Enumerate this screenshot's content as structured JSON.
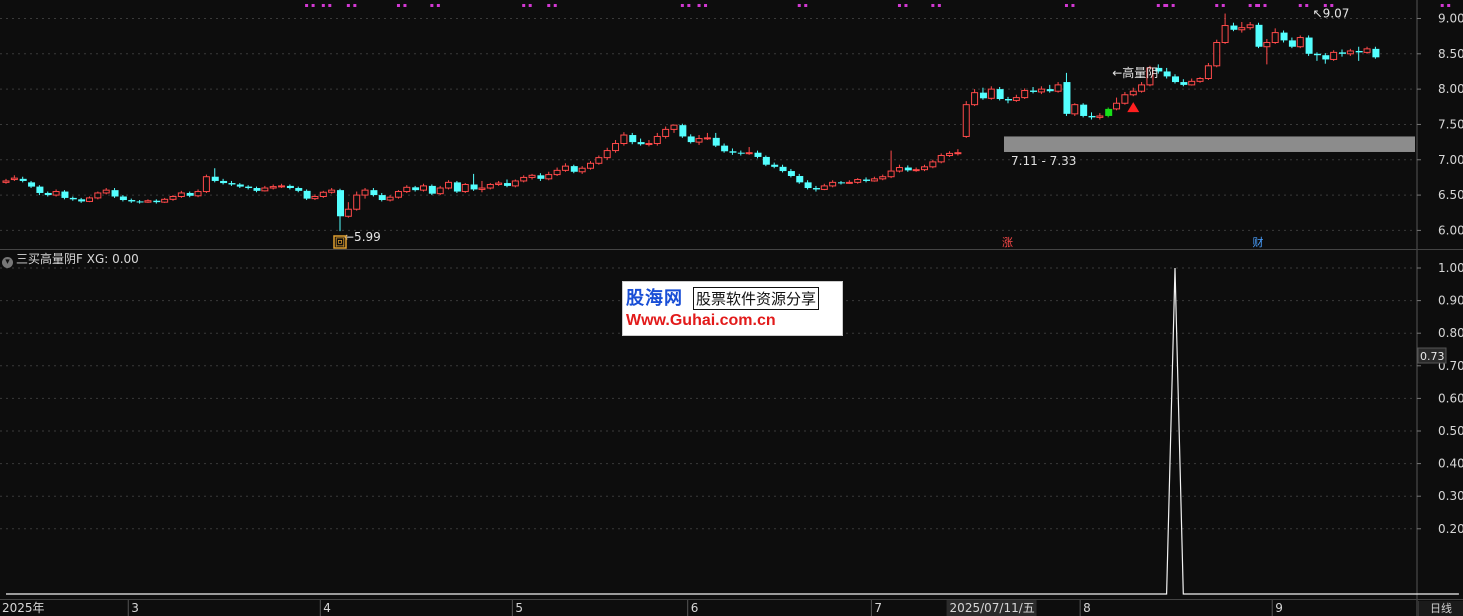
{
  "indicator": {
    "icon": "chevron-down-icon",
    "title": "三买高量阴F XG: 0.00"
  },
  "watermark": {
    "brand": "股海网",
    "subtitle": "股票软件资源分享",
    "url": "Www.Guhai.com.cn"
  },
  "period_label": "日线",
  "colors": {
    "up": "#ff4a4a",
    "down": "#54ffff",
    "bg": "#0d0d0d",
    "grid": "#3a3a3a",
    "axis_text": "#d6d6d6",
    "marker": "#d238d2",
    "zone": "#8c8c8c",
    "green_bar": "#18e018"
  },
  "chart_data": [
    {
      "type": "candlestick",
      "y_ticks": [
        "9.00",
        "8.50",
        "8.00",
        "7.50",
        "7.00",
        "6.50",
        "6.00"
      ],
      "ylim": [
        5.85,
        9.12
      ],
      "grid": true,
      "candles": [
        [
          6.68,
          6.7,
          6.73,
          6.66
        ],
        [
          6.72,
          6.74,
          6.78,
          6.7
        ],
        [
          6.73,
          6.7,
          6.76,
          6.68
        ],
        [
          6.68,
          6.62,
          6.7,
          6.6
        ],
        [
          6.62,
          6.53,
          6.64,
          6.5
        ],
        [
          6.53,
          6.5,
          6.55,
          6.48
        ],
        [
          6.5,
          6.55,
          6.58,
          6.48
        ],
        [
          6.55,
          6.46,
          6.57,
          6.44
        ],
        [
          6.46,
          6.44,
          6.48,
          6.42
        ],
        [
          6.44,
          6.41,
          6.46,
          6.39
        ],
        [
          6.41,
          6.46,
          6.48,
          6.4
        ],
        [
          6.46,
          6.53,
          6.55,
          6.44
        ],
        [
          6.53,
          6.57,
          6.6,
          6.51
        ],
        [
          6.57,
          6.48,
          6.6,
          6.46
        ],
        [
          6.48,
          6.43,
          6.5,
          6.41
        ],
        [
          6.43,
          6.41,
          6.45,
          6.39
        ],
        [
          6.41,
          6.4,
          6.43,
          6.38
        ],
        [
          6.4,
          6.42,
          6.44,
          6.39
        ],
        [
          6.42,
          6.4,
          6.44,
          6.38
        ],
        [
          6.4,
          6.44,
          6.46,
          6.39
        ],
        [
          6.44,
          6.48,
          6.5,
          6.42
        ],
        [
          6.48,
          6.53,
          6.56,
          6.46
        ],
        [
          6.53,
          6.49,
          6.55,
          6.47
        ],
        [
          6.49,
          6.55,
          6.58,
          6.47
        ],
        [
          6.55,
          6.76,
          6.79,
          6.53
        ],
        [
          6.76,
          6.7,
          6.88,
          6.68
        ],
        [
          6.7,
          6.67,
          6.73,
          6.65
        ],
        [
          6.67,
          6.65,
          6.7,
          6.63
        ],
        [
          6.65,
          6.62,
          6.67,
          6.6
        ],
        [
          6.62,
          6.6,
          6.64,
          6.58
        ],
        [
          6.6,
          6.56,
          6.62,
          6.54
        ],
        [
          6.56,
          6.6,
          6.63,
          6.55
        ],
        [
          6.6,
          6.62,
          6.65,
          6.58
        ],
        [
          6.62,
          6.63,
          6.66,
          6.6
        ],
        [
          6.63,
          6.6,
          6.65,
          6.58
        ],
        [
          6.6,
          6.56,
          6.62,
          6.54
        ],
        [
          6.56,
          6.45,
          6.58,
          6.43
        ],
        [
          6.45,
          6.48,
          6.51,
          6.43
        ],
        [
          6.48,
          6.54,
          6.56,
          6.46
        ],
        [
          6.54,
          6.57,
          6.6,
          6.52
        ],
        [
          6.57,
          6.2,
          6.59,
          5.99
        ],
        [
          6.2,
          6.3,
          6.4,
          6.18
        ],
        [
          6.3,
          6.5,
          6.55,
          6.28
        ],
        [
          6.5,
          6.57,
          6.6,
          6.45
        ],
        [
          6.57,
          6.5,
          6.6,
          6.48
        ],
        [
          6.5,
          6.43,
          6.53,
          6.41
        ],
        [
          6.43,
          6.47,
          6.5,
          6.41
        ],
        [
          6.47,
          6.55,
          6.57,
          6.45
        ],
        [
          6.55,
          6.61,
          6.64,
          6.53
        ],
        [
          6.61,
          6.57,
          6.63,
          6.55
        ],
        [
          6.57,
          6.63,
          6.66,
          6.55
        ],
        [
          6.63,
          6.52,
          6.65,
          6.5
        ],
        [
          6.52,
          6.6,
          6.63,
          6.5
        ],
        [
          6.6,
          6.68,
          6.71,
          6.58
        ],
        [
          6.68,
          6.55,
          6.7,
          6.53
        ],
        [
          6.55,
          6.65,
          6.67,
          6.53
        ],
        [
          6.65,
          6.58,
          6.8,
          6.56
        ],
        [
          6.58,
          6.6,
          6.7,
          6.54
        ],
        [
          6.6,
          6.65,
          6.67,
          6.58
        ],
        [
          6.65,
          6.67,
          6.7,
          6.63
        ],
        [
          6.67,
          6.63,
          6.72,
          6.61
        ],
        [
          6.63,
          6.7,
          6.72,
          6.61
        ],
        [
          6.7,
          6.75,
          6.78,
          6.68
        ],
        [
          6.75,
          6.78,
          6.8,
          6.72
        ],
        [
          6.78,
          6.73,
          6.81,
          6.7
        ],
        [
          6.73,
          6.79,
          6.83,
          6.71
        ],
        [
          6.79,
          6.85,
          6.89,
          6.77
        ],
        [
          6.85,
          6.91,
          6.95,
          6.83
        ],
        [
          6.91,
          6.83,
          6.93,
          6.81
        ],
        [
          6.83,
          6.88,
          6.91,
          6.8
        ],
        [
          6.88,
          6.95,
          6.98,
          6.86
        ],
        [
          6.95,
          7.03,
          7.06,
          6.93
        ],
        [
          7.03,
          7.13,
          7.17,
          7.0
        ],
        [
          7.13,
          7.23,
          7.28,
          7.1
        ],
        [
          7.23,
          7.35,
          7.39,
          7.2
        ],
        [
          7.35,
          7.25,
          7.38,
          7.22
        ],
        [
          7.25,
          7.22,
          7.3,
          7.2
        ],
        [
          7.22,
          7.23,
          7.28,
          7.19
        ],
        [
          7.23,
          7.33,
          7.38,
          7.2
        ],
        [
          7.33,
          7.43,
          7.47,
          7.3
        ],
        [
          7.43,
          7.49,
          7.5,
          7.38
        ],
        [
          7.49,
          7.33,
          7.51,
          7.31
        ],
        [
          7.33,
          7.25,
          7.36,
          7.23
        ],
        [
          7.25,
          7.3,
          7.35,
          7.21
        ],
        [
          7.3,
          7.31,
          7.38,
          7.28
        ],
        [
          7.31,
          7.2,
          7.38,
          7.18
        ],
        [
          7.2,
          7.12,
          7.23,
          7.1
        ],
        [
          7.12,
          7.1,
          7.16,
          7.07
        ],
        [
          7.1,
          7.09,
          7.13,
          7.06
        ],
        [
          7.09,
          7.1,
          7.18,
          7.07
        ],
        [
          7.1,
          7.04,
          7.13,
          7.02
        ],
        [
          7.04,
          6.93,
          7.06,
          6.91
        ],
        [
          6.93,
          6.9,
          6.96,
          6.88
        ],
        [
          6.9,
          6.84,
          6.93,
          6.82
        ],
        [
          6.84,
          6.77,
          6.87,
          6.75
        ],
        [
          6.77,
          6.68,
          6.8,
          6.66
        ],
        [
          6.68,
          6.6,
          6.71,
          6.58
        ],
        [
          6.6,
          6.58,
          6.63,
          6.55
        ],
        [
          6.58,
          6.63,
          6.66,
          6.57
        ],
        [
          6.63,
          6.68,
          6.71,
          6.61
        ],
        [
          6.68,
          6.67,
          6.7,
          6.65
        ],
        [
          6.67,
          6.68,
          6.71,
          6.66
        ],
        [
          6.68,
          6.72,
          6.74,
          6.66
        ],
        [
          6.72,
          6.7,
          6.75,
          6.68
        ],
        [
          6.7,
          6.73,
          6.76,
          6.69
        ],
        [
          6.73,
          6.76,
          6.79,
          6.71
        ],
        [
          6.76,
          6.84,
          7.13,
          6.74
        ],
        [
          6.84,
          6.89,
          6.93,
          6.82
        ],
        [
          6.89,
          6.85,
          6.92,
          6.83
        ],
        [
          6.85,
          6.86,
          6.89,
          6.83
        ],
        [
          6.86,
          6.9,
          6.93,
          6.84
        ],
        [
          6.9,
          6.97,
          7.0,
          6.88
        ],
        [
          6.97,
          7.06,
          7.09,
          6.95
        ],
        [
          7.06,
          7.09,
          7.12,
          7.04
        ],
        [
          7.09,
          7.1,
          7.15,
          7.06
        ],
        [
          7.33,
          7.78,
          7.83,
          7.31
        ],
        [
          7.78,
          7.95,
          8.0,
          7.76
        ],
        [
          7.95,
          7.87,
          8.02,
          7.85
        ],
        [
          7.87,
          8.0,
          8.04,
          7.85
        ],
        [
          8.0,
          7.86,
          8.03,
          7.84
        ],
        [
          7.86,
          7.84,
          7.89,
          7.8
        ],
        [
          7.84,
          7.88,
          7.92,
          7.82
        ],
        [
          7.88,
          7.98,
          8.01,
          7.86
        ],
        [
          7.98,
          7.96,
          8.03,
          7.94
        ],
        [
          7.96,
          8.0,
          8.04,
          7.93
        ],
        [
          8.0,
          7.97,
          8.06,
          7.95
        ],
        [
          7.97,
          8.06,
          8.1,
          7.95
        ],
        [
          8.1,
          7.65,
          8.23,
          7.62
        ],
        [
          7.65,
          7.78,
          7.8,
          7.62
        ],
        [
          7.78,
          7.62,
          7.8,
          7.6
        ],
        [
          7.62,
          7.6,
          7.67,
          7.57
        ],
        [
          7.6,
          7.62,
          7.66,
          7.57
        ],
        [
          7.62,
          7.72,
          7.74,
          7.6
        ],
        [
          7.72,
          7.8,
          7.88,
          7.7
        ],
        [
          7.8,
          7.92,
          7.96,
          7.78
        ],
        [
          7.92,
          7.97,
          8.02,
          7.9
        ],
        [
          7.97,
          8.06,
          8.1,
          7.95
        ],
        [
          8.06,
          8.3,
          8.33,
          8.04
        ],
        [
          8.3,
          8.25,
          8.35,
          8.22
        ],
        [
          8.25,
          8.18,
          8.3,
          8.15
        ],
        [
          8.18,
          8.1,
          8.21,
          8.08
        ],
        [
          8.1,
          8.06,
          8.14,
          8.04
        ],
        [
          8.06,
          8.11,
          8.15,
          8.05
        ],
        [
          8.11,
          8.15,
          8.17,
          8.09
        ],
        [
          8.15,
          8.33,
          8.37,
          8.13
        ],
        [
          8.33,
          8.66,
          8.7,
          8.31
        ],
        [
          8.66,
          8.9,
          9.07,
          8.64
        ],
        [
          8.9,
          8.84,
          8.94,
          8.82
        ],
        [
          8.84,
          8.87,
          8.95,
          8.8
        ],
        [
          8.87,
          8.91,
          8.95,
          8.84
        ],
        [
          8.91,
          8.6,
          8.94,
          8.58
        ],
        [
          8.6,
          8.66,
          8.71,
          8.35
        ],
        [
          8.66,
          8.8,
          8.86,
          8.64
        ],
        [
          8.8,
          8.69,
          8.83,
          8.66
        ],
        [
          8.69,
          8.6,
          8.73,
          8.58
        ],
        [
          8.6,
          8.73,
          8.76,
          8.58
        ],
        [
          8.73,
          8.5,
          8.76,
          8.47
        ],
        [
          8.5,
          8.48,
          8.52,
          8.4
        ],
        [
          8.48,
          8.42,
          8.51,
          8.36
        ],
        [
          8.42,
          8.52,
          8.55,
          8.4
        ],
        [
          8.52,
          8.5,
          8.56,
          8.46
        ],
        [
          8.5,
          8.54,
          8.57,
          8.47
        ],
        [
          8.54,
          8.52,
          8.6,
          8.4
        ],
        [
          8.52,
          8.57,
          8.6,
          8.5
        ],
        [
          8.57,
          8.45,
          8.6,
          8.43
        ]
      ],
      "annotations": [
        {
          "text": "←5.99",
          "index": 40,
          "value": 5.99
        },
        {
          "text": "←高量阴",
          "index": 132,
          "value": 8.23
        },
        {
          "text": "↖9.07",
          "index": 156,
          "value": 9.07
        }
      ],
      "zone": {
        "low": 7.11,
        "high": 7.33,
        "label": "7.11 - 7.33",
        "start_index": 120
      },
      "signal_arrow_index": 135,
      "marks": [
        {
          "text": "回",
          "index": 40
        },
        {
          "text": "涨",
          "index": 120
        },
        {
          "text": "财",
          "index": 150
        }
      ],
      "marker_indices": [
        36,
        38,
        41,
        47,
        51,
        62,
        65,
        81,
        83,
        95,
        107,
        111,
        127,
        138,
        139,
        145,
        149,
        150,
        155,
        158,
        172
      ]
    },
    {
      "type": "line",
      "series": [
        {
          "name": "XG",
          "values_sparse": {
            "140": 1
          }
        }
      ],
      "length": 175,
      "y_ticks": [
        "1.00",
        "0.90",
        "0.80",
        "0.70",
        "0.60",
        "0.50",
        "0.40",
        "0.30",
        "0.20"
      ],
      "ylim": [
        0,
        1
      ],
      "current_value": "0.73",
      "x_labels": [
        {
          "text": "2025年",
          "index": 0
        },
        {
          "text": "3",
          "index": 15
        },
        {
          "text": "4",
          "index": 38
        },
        {
          "text": "5",
          "index": 61
        },
        {
          "text": "6",
          "index": 82
        },
        {
          "text": "7",
          "index": 104
        },
        {
          "text": "2025/07/11/五",
          "index": 113,
          "highlight": true
        },
        {
          "text": "8",
          "index": 129
        },
        {
          "text": "9",
          "index": 152
        }
      ]
    }
  ]
}
